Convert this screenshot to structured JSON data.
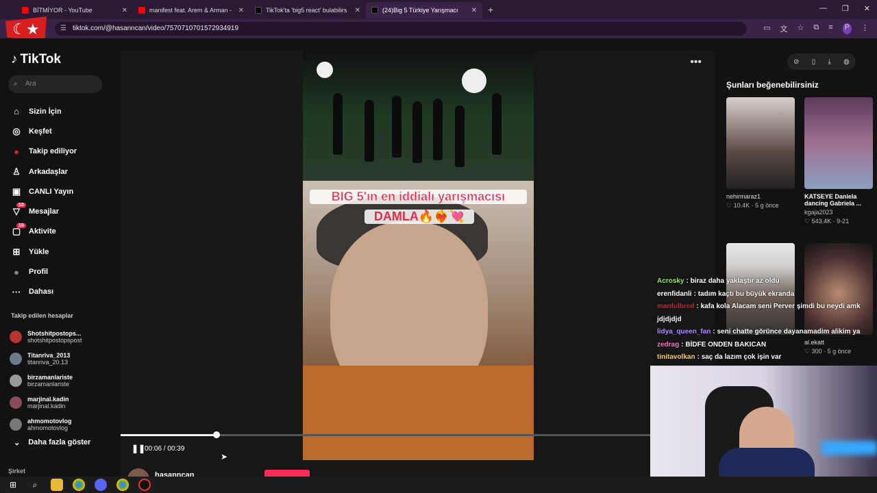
{
  "tabs": [
    {
      "title": "BİTMİYOR - YouTube",
      "color": "#ff0000"
    },
    {
      "title": "manifest feat. Arem & Arman -",
      "color": "#ff0000"
    },
    {
      "title": "TikTok'ta 'big5 react' bulabilirs",
      "color": "#000000"
    },
    {
      "title": "(24)Big 5 Türkiye Yarışmacı",
      "color": "#000000"
    }
  ],
  "address": "tiktok.com/@hasanncan/video/7570710701572934919",
  "brand": "TikTok",
  "search_placeholder": "Ara",
  "nav": [
    {
      "label": "Sizin İçin",
      "icon": "home-icon",
      "glyph": "⌂"
    },
    {
      "label": "Keşfet",
      "icon": "compass-icon",
      "glyph": "◎"
    },
    {
      "label": "Takip ediliyor",
      "icon": "following-avatar-icon",
      "glyph": "●"
    },
    {
      "label": "Arkadaşlar",
      "icon": "friends-icon",
      "glyph": "👥"
    },
    {
      "label": "CANLI Yayın",
      "icon": "live-icon",
      "glyph": "▣"
    },
    {
      "label": "Mesajlar",
      "icon": "messages-icon",
      "glyph": "▽",
      "badge": "10"
    },
    {
      "label": "Aktivite",
      "icon": "activity-icon",
      "glyph": "▢",
      "badge": "15"
    },
    {
      "label": "Yükle",
      "icon": "upload-icon",
      "glyph": "⊞"
    },
    {
      "label": "Profil",
      "icon": "profile-avatar-icon",
      "glyph": "●"
    },
    {
      "label": "Dahası",
      "icon": "more-icon",
      "glyph": "···"
    }
  ],
  "following_header": "Takip edilen hesaplar",
  "following": [
    {
      "name": "Shotshitpostops...",
      "handle": "shotshitpostopspost"
    },
    {
      "name": "Titanriva_2013",
      "handle": "titanriva_20.13"
    },
    {
      "name": "birzamanlariste",
      "handle": "birzamanlariste"
    },
    {
      "name": "marjinal.kadin",
      "handle": "marjinal.kadin"
    },
    {
      "name": "ahmomotovlog",
      "handle": "ahmomotovlog"
    }
  ],
  "show_more": "Daha fazla göster",
  "company": "Şirket",
  "video": {
    "caption_line1": "BIG 5'ın en iddialı yarışmacısı",
    "caption_line2": "DAMLA🔥❤️‍🔥💘",
    "time": "00:06 / 00:39",
    "progress": 0.18,
    "author": "hasanncan"
  },
  "suggest_header": "Şunları beğenebilirsiniz",
  "suggestions": [
    {
      "title": "nehirmaraz1",
      "meta": "♡ 10.4K · 5 g önce",
      "color": "#bfb6b0"
    },
    {
      "title": "KATSEYE Daniela dancing Gabriela ...",
      "sub": "kgaja2023",
      "meta": "♡ 543.4K · 9-21",
      "color": "#7a5a7a"
    },
    {
      "title": "al.ekatt",
      "meta": "♡ 300 · 5 g önce",
      "color": "#4a3a3a"
    }
  ],
  "chat": [
    {
      "user": "Acrosky",
      "color": "#9be36a",
      "msg": "biraz daha yaklaştır az oldu"
    },
    {
      "user": "erenfidanli",
      "color": "#ffffff",
      "msg": "tadım kaçtı bu büyük ekranda"
    },
    {
      "user": "manfulbred",
      "color": "#c0283a",
      "msg": "kafa kola Alacam seni Perver şimdi bu neydi amk jdjdjdjd"
    },
    {
      "user": "lidya_queen_fan",
      "color": "#b48cff",
      "msg": "seni chatte görünce dayanamadim alikim ya"
    },
    {
      "user": "zedrag",
      "color": "#ff6fd0",
      "msg": "BİDFE ONDEN BAKICAN"
    },
    {
      "user": "tinitavolkan",
      "color": "#ffd34d",
      "msg": "saç da lazım çok işin var"
    }
  ]
}
